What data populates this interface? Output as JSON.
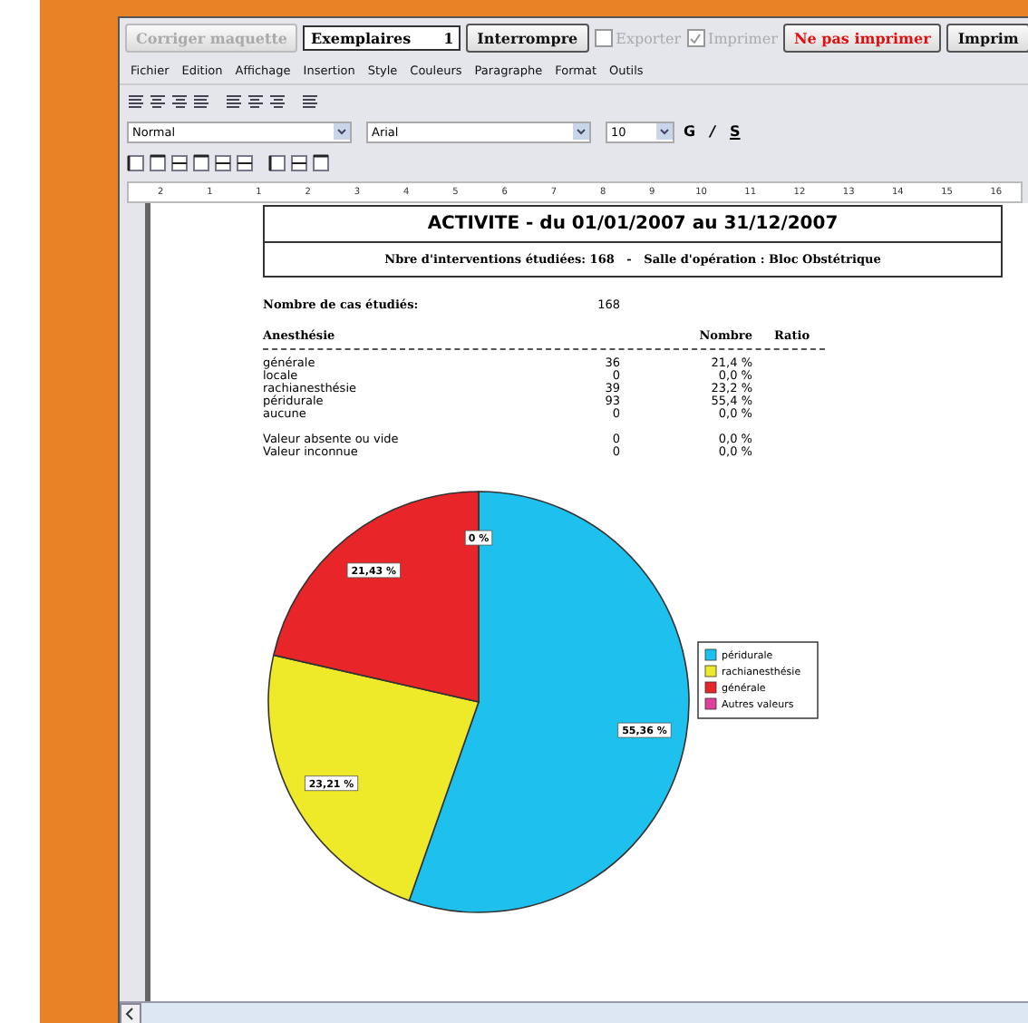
{
  "toolbar": {
    "buttons": [
      {
        "label": "Corriger maquette",
        "disabled": true,
        "kind": "button"
      },
      {
        "label": "Exemplaires",
        "value": "1",
        "kind": "field"
      },
      {
        "label": "Interrompre",
        "disabled": false,
        "kind": "button"
      },
      {
        "label": "Exporter",
        "disabled": true,
        "checked": false,
        "kind": "checkbox"
      },
      {
        "label": "Imprimer",
        "disabled": true,
        "checked": true,
        "kind": "checkbox"
      },
      {
        "label": "Ne pas imprimer",
        "disabled": false,
        "kind": "danger"
      },
      {
        "label": "Imprim",
        "disabled": false,
        "kind": "button"
      }
    ]
  },
  "menu": [
    "Fichier",
    "Edition",
    "Affichage",
    "Insertion",
    "Style",
    "Couleurs",
    "Paragraphe",
    "Format",
    "Outils"
  ],
  "format_bar": {
    "style": "Normal",
    "font": "Arial",
    "size": "10",
    "bold": "G",
    "italic": "/",
    "underline": "S"
  },
  "ruler": [
    "2",
    "1",
    "1",
    "2",
    "3",
    "4",
    "5",
    "6",
    "7",
    "8",
    "9",
    "10",
    "11",
    "12",
    "13",
    "14",
    "15",
    "16"
  ],
  "document": {
    "title": "ACTIVITE - du 01/01/2007 au 31/12/2007",
    "subtitle": "Nbre d'interventions étudiées: 168   -   Salle d'opération : Bloc Obstétrique",
    "cases_label": "Nombre de cas étudiés:",
    "cases_value": "168",
    "columns": [
      "Anesthésie",
      "Nombre",
      "Ratio"
    ],
    "rows": [
      {
        "label": "générale",
        "count": "36",
        "ratio": "21,4 %"
      },
      {
        "label": "locale",
        "count": "0",
        "ratio": "0,0 %"
      },
      {
        "label": "rachianesthésie",
        "count": "39",
        "ratio": "23,2 %"
      },
      {
        "label": "péridurale",
        "count": "93",
        "ratio": "55,4 %"
      },
      {
        "label": "aucune",
        "count": "0",
        "ratio": "0,0 %"
      }
    ],
    "extra_rows": [
      {
        "label": "Valeur absente ou vide",
        "count": "0",
        "ratio": "0,0 %"
      },
      {
        "label": "Valeur inconnue",
        "count": "0",
        "ratio": "0,0 %"
      }
    ],
    "chart_data": {
      "type": "pie",
      "data_labels": true,
      "categories": [
        "péridurale",
        "rachianesthésie",
        "générale",
        "Autres valeurs"
      ],
      "values": [
        55.36,
        23.21,
        21.43,
        0
      ],
      "colors": [
        "#1ec0ee",
        "#eeea2a",
        "#e8262a",
        "#e040a0"
      ],
      "legend": "right",
      "value_labels": [
        "55,36 %",
        "23,21 %",
        "21,43 %",
        "0 %"
      ]
    }
  }
}
